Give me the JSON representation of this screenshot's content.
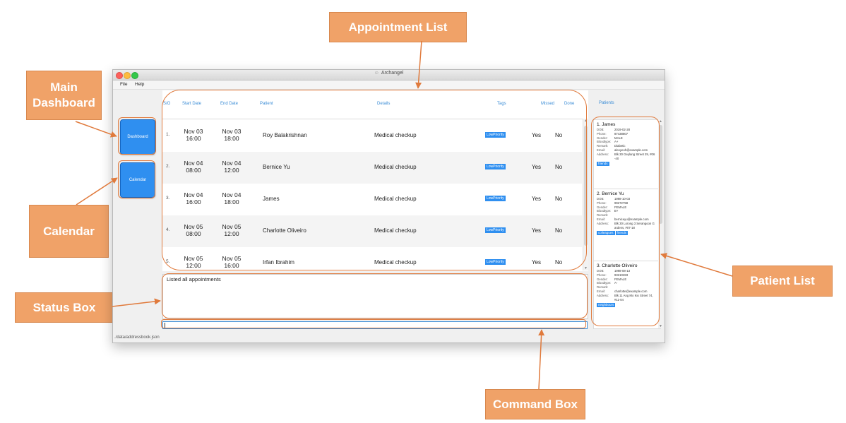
{
  "window": {
    "title": "Archangel",
    "app_icon": "person-icon"
  },
  "menu": [
    "File",
    "Help"
  ],
  "sidebar": {
    "dashboard_label": "Dashboard",
    "calendar_label": "Calendar"
  },
  "appointments": {
    "headers": {
      "sno": "S/O",
      "start": "Start Date",
      "end": "End Date",
      "patient": "Patient",
      "details": "Details",
      "tags": "Tags",
      "missed": "Missed",
      "done": "Done"
    },
    "rows": [
      {
        "sno": "1.",
        "start_date": "Nov 03",
        "start_time": "16:00",
        "end_date": "Nov 03",
        "end_time": "18:00",
        "patient": "Roy Balakrishnan",
        "details": "Medical checkup",
        "tag": "LowPriority",
        "missed": "Yes",
        "done": "No"
      },
      {
        "sno": "2.",
        "start_date": "Nov 04",
        "start_time": "08:00",
        "end_date": "Nov 04",
        "end_time": "12:00",
        "patient": "Bernice Yu",
        "details": "Medical checkup",
        "tag": "LowPriority",
        "missed": "Yes",
        "done": "No"
      },
      {
        "sno": "3.",
        "start_date": "Nov 04",
        "start_time": "16:00",
        "end_date": "Nov 04",
        "end_time": "18:00",
        "patient": "James",
        "details": "Medical checkup",
        "tag": "LowPriority",
        "missed": "Yes",
        "done": "No"
      },
      {
        "sno": "4.",
        "start_date": "Nov 05",
        "start_time": "08:00",
        "end_date": "Nov 05",
        "end_time": "12:00",
        "patient": "Charlotte Oliveiro",
        "details": "Medical checkup",
        "tag": "LowPriority",
        "missed": "Yes",
        "done": "No"
      },
      {
        "sno": "5.",
        "start_date": "Nov 05",
        "start_time": "12:00",
        "end_date": "Nov 05",
        "end_time": "16:00",
        "patient": "Irfan Ibrahim",
        "details": "Medical checkup",
        "tag": "LowPriority",
        "missed": "Yes",
        "done": "No"
      }
    ]
  },
  "status": {
    "text": "Listed all appointments"
  },
  "command": {
    "value": ""
  },
  "footer": {
    "path": "./data/addressbook.json"
  },
  "patients": {
    "header": "Patients",
    "field_labels": {
      "dob": "DOB:",
      "phone": "Phone:",
      "gender": "Gender:",
      "bloodtype": "Bloodtype:",
      "remark": "Remark:",
      "email": "Email:",
      "address": "Address:"
    },
    "items": [
      {
        "name": "1. James",
        "dob": "2019-02-28",
        "phone": "87438807",
        "gender": "MALE",
        "bloodtype": "A+",
        "remark": "Diabetic",
        "email": "alexyeoh@example.com",
        "address": "Blk 30 Geylang Street 29, #06-40",
        "tags": [
          "friends"
        ]
      },
      {
        "name": "2. Bernice Yu",
        "dob": "1998-10-03",
        "phone": "99272758",
        "gender": "FEMALE",
        "bloodtype": "B+",
        "remark": "",
        "email": "berniceyu@example.com",
        "address": "Blk 30 Lorong 3 Serangoon Gardens, #07-18",
        "tags": [
          "colleagues",
          "friends"
        ]
      },
      {
        "name": "3. Charlotte Oliveiro",
        "dob": "1998-08-13",
        "phone": "93210283",
        "gender": "FEMALE",
        "bloodtype": "A-",
        "remark": "",
        "email": "charlotte@example.com",
        "address": "Blk 11 Ang Mo Kio Street 74, #11-04",
        "tags": [
          "neighbours"
        ]
      }
    ]
  },
  "annotations": {
    "appointment_list": "Appointment List",
    "main_dashboard": "Main Dashboard",
    "calendar": "Calendar",
    "status_box": "Status Box",
    "patient_list": "Patient List",
    "command_box": "Command Box"
  },
  "colors": {
    "accent": "#2f8ff0",
    "header_text": "#3a8cd6",
    "callout_fill": "#f0a268",
    "callout_line": "#e07a3c"
  }
}
